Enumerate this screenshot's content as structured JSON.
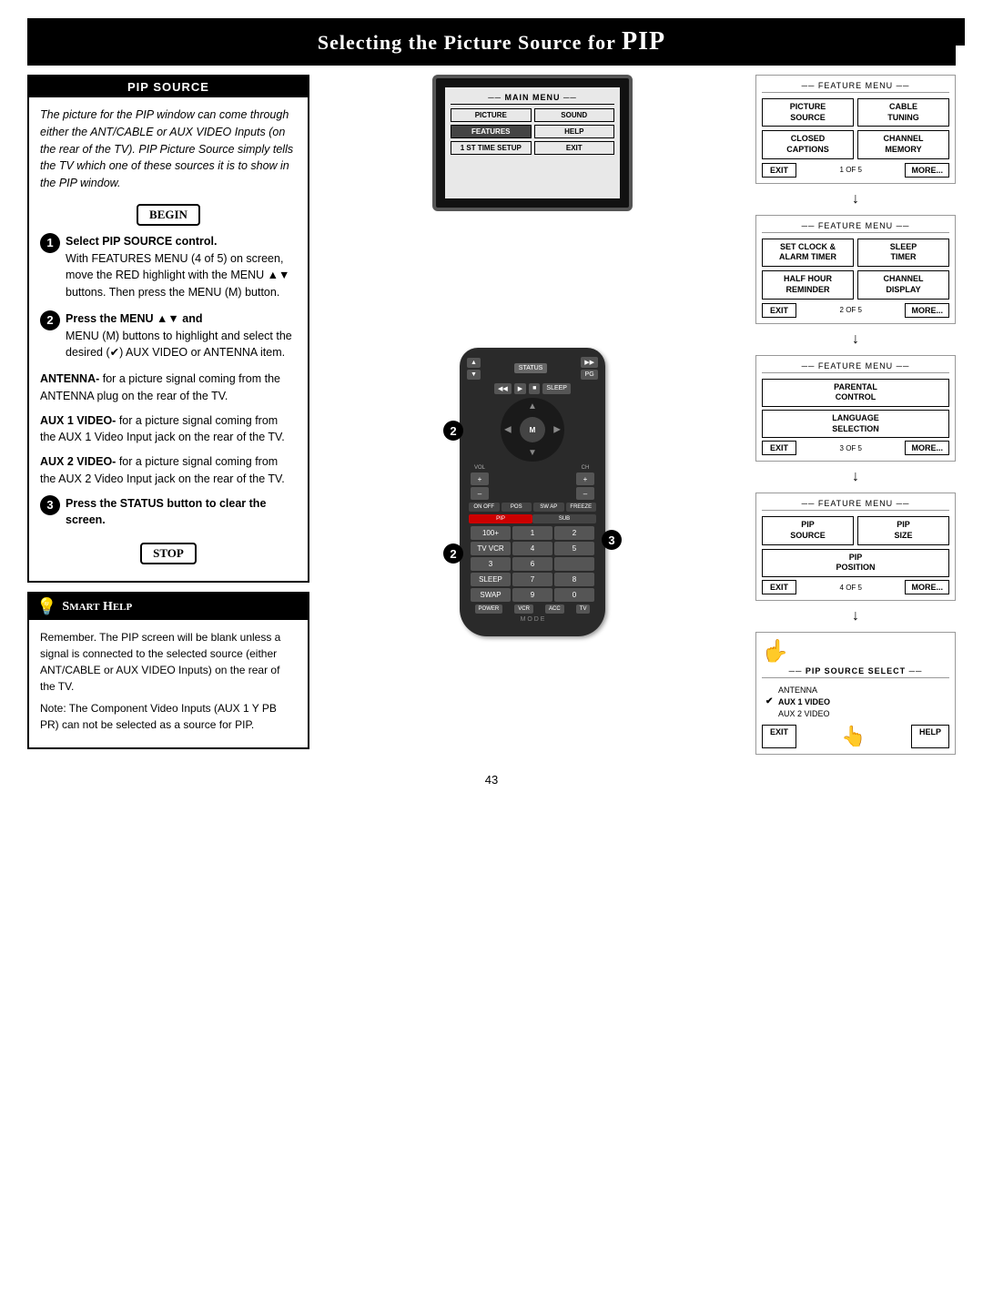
{
  "header": {
    "title": "Selecting the Picture Source for ",
    "title_pip": "PIP"
  },
  "pip_source_box": {
    "header": "PIP SOURCE",
    "intro": "The picture for the PIP window can come through either the ANT/CABLE or AUX VIDEO Inputs (on the rear of the TV). PIP Picture Source simply tells the TV which one of these sources it is to show in the PIP window.",
    "begin_label": "BEGIN",
    "step1_label": "Select PIP SOURCE control.",
    "step1_detail": "With FEATURES MENU (4 of 5) on screen, move the RED highlight with the MENU",
    "step1_detail2": "buttons. Then press the MENU (M) button.",
    "step2_label": "Press the MENU ▲▼ and",
    "step2_detail": "MENU (M) buttons to highlight and select the desired (✔) AUX VIDEO or ANTENNA item.",
    "antenna_label": "ANTENNA-",
    "antenna_text": " for a picture signal coming from the ANTENNA plug on the rear of the TV.",
    "aux1_label": "AUX 1 VIDEO-",
    "aux1_text": " for a picture signal coming from the AUX 1 Video Input jack on the rear of the TV.",
    "aux2_label": "AUX 2 VIDEO-",
    "aux2_text": " for a picture signal coming from the AUX 2 Video Input jack on the rear of the TV.",
    "step3_label": "Press the STATUS button to clear the screen.",
    "stop_label": "STOP"
  },
  "smart_help": {
    "header": "Smart Help",
    "lightbulb": "💡",
    "p1": "Remember. The PIP screen will be blank unless a signal is connected to the selected source (either ANT/CABLE or AUX VIDEO Inputs) on the rear of the TV.",
    "p2": "Note: The Component Video Inputs (AUX 1 Y PB PR) can not be selected as a source for PIP."
  },
  "tv_screen": {
    "menu_label": "MAIN MENU",
    "items": [
      {
        "label": "PICTURE",
        "highlight": false
      },
      {
        "label": "SOUND",
        "highlight": false
      },
      {
        "label": "FEATURES",
        "highlight": true
      },
      {
        "label": "HELP",
        "highlight": false
      },
      {
        "label": "1 ST TIME SETUP",
        "highlight": false
      },
      {
        "label": "EXIT",
        "highlight": false
      }
    ]
  },
  "remote": {
    "status_btn": "STATUS",
    "ch_label": "CH",
    "vol_label": "VOL",
    "m_label": "M",
    "pip_label": "PIP",
    "sub_label": "SUB",
    "power_label": "POWER",
    "vcr_label": "VCR",
    "acc_label": "ACC",
    "tv_label": "TV",
    "mode_label": "M O D E",
    "sleep_label": "SLEEP",
    "swap_label": "SWAP",
    "freeze_label": "FREEZE"
  },
  "menus": {
    "menu1": {
      "title": "FEATURE MENU",
      "items": [
        {
          "label": "PICTURE\nSOURCE",
          "col": 1
        },
        {
          "label": "CABLE\nTUNING",
          "col": 2
        },
        {
          "label": "CLOSED\nCAPTIONS",
          "col": 1
        },
        {
          "label": "CHANNEL\nMEMORY",
          "col": 2
        }
      ],
      "exit": "EXIT",
      "more": "MORE...",
      "page": "1 OF 5"
    },
    "menu2": {
      "title": "FEATURE MENU",
      "items": [
        {
          "label": "SET CLOCK &\nALARM TIMER",
          "col": 1
        },
        {
          "label": "SLEEP\nTIMER",
          "col": 2
        },
        {
          "label": "HALF HOUR\nREMINDER",
          "col": 1
        },
        {
          "label": "CHANNEL\nDISPLAY",
          "col": 2
        }
      ],
      "exit": "EXIT",
      "more": "MORE...",
      "page": "2 OF 5"
    },
    "menu3": {
      "title": "FEATURE MENU",
      "items": [
        {
          "label": "PARENTAL\nCONTROL",
          "col": 1
        },
        {
          "label": "LANGUAGE\nSELECTION",
          "col": 1
        }
      ],
      "exit": "EXIT",
      "more": "MORE...",
      "page": "3 OF 5"
    },
    "menu4": {
      "title": "FEATURE MENU",
      "items": [
        {
          "label": "PIP\nSOURCE",
          "col": 1
        },
        {
          "label": "PIP\nSIZE",
          "col": 2
        },
        {
          "label": "PIP\nPOSITION",
          "col": 1
        }
      ],
      "exit": "EXIT",
      "more": "MORE...",
      "page": "4 OF 5"
    },
    "pip_select": {
      "title": "PIP SOURCE SELECT",
      "options": [
        "ANTENNA",
        "AUX 1 VIDEO",
        "AUX 2 VIDEO"
      ],
      "selected": 1,
      "exit": "EXIT",
      "help": "HELP"
    }
  },
  "page_number": "43"
}
